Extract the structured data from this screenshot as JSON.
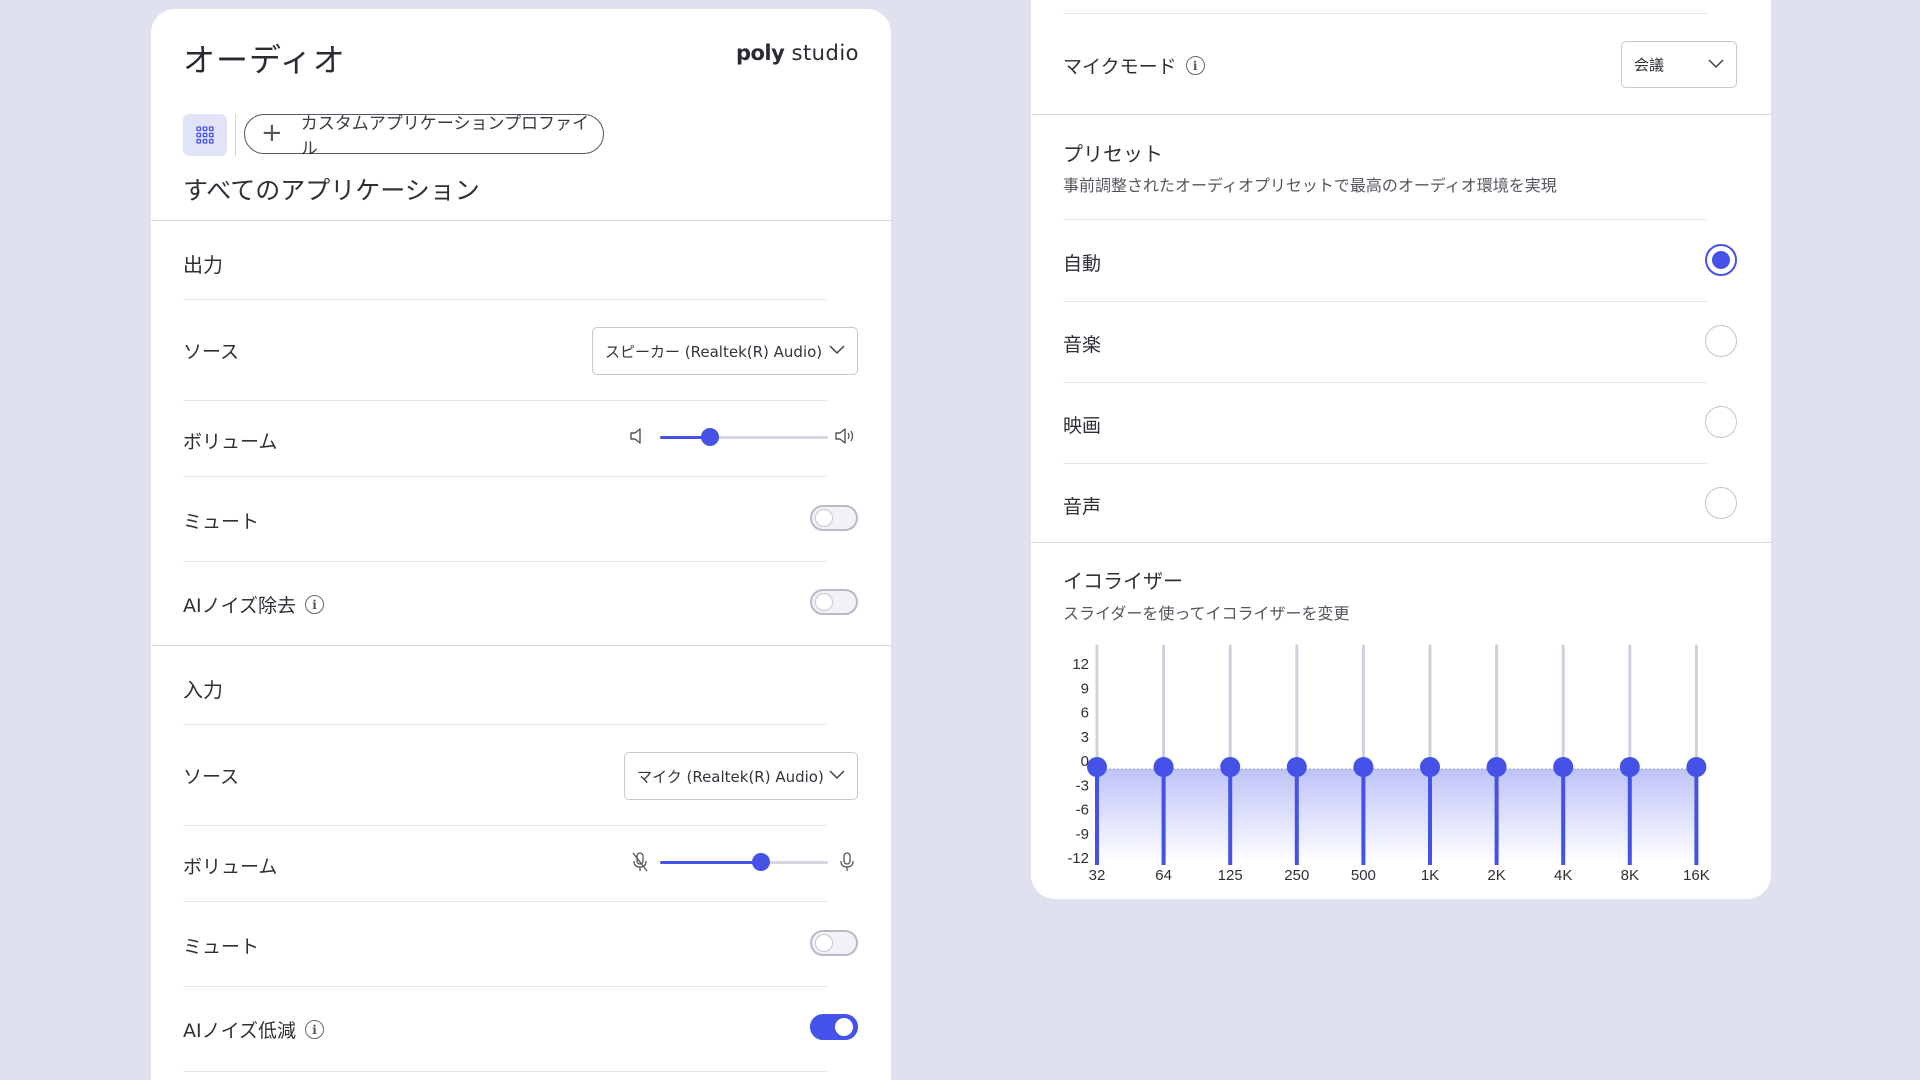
{
  "header": {
    "title": "オーディオ",
    "logo_bold": "poly",
    "logo_light": "studio"
  },
  "profiles": {
    "add_label": "カスタムアプリケーションプロファイル",
    "current": "すべてのアプリケーション"
  },
  "output": {
    "title": "出力",
    "source_label": "ソース",
    "source_value": "スピーカー (Realtek(R) Audio)",
    "volume_label": "ボリューム",
    "volume": 0.3,
    "mute_label": "ミュート",
    "mute_on": false,
    "noise_label": "AIノイズ除去",
    "noise_on": false
  },
  "input": {
    "title": "入力",
    "source_label": "ソース",
    "source_value": "マイク (Realtek(R) Audio)",
    "volume_label": "ボリューム",
    "volume": 0.6,
    "mute_label": "ミュート",
    "mute_on": false,
    "noise_label": "AIノイズ低減",
    "noise_on": true
  },
  "mic_mode": {
    "label": "マイクモード",
    "value": "会議"
  },
  "preset": {
    "title": "プリセット",
    "subtitle": "事前調整されたオーディオプリセットで最高のオーディオ環境を実現",
    "options": [
      {
        "label": "自動",
        "selected": true
      },
      {
        "label": "音楽",
        "selected": false
      },
      {
        "label": "映画",
        "selected": false
      },
      {
        "label": "音声",
        "selected": false
      }
    ]
  },
  "equalizer": {
    "title": "イコライザー",
    "subtitle": "スライダーを使ってイコライザーを変更",
    "y_ticks": [
      "12",
      "9",
      "6",
      "3",
      "0",
      "-3",
      "-6",
      "-9",
      "-12"
    ],
    "ylim": [
      -12,
      12
    ],
    "bands": [
      {
        "label": "32",
        "gain": 0
      },
      {
        "label": "64",
        "gain": 0
      },
      {
        "label": "125",
        "gain": 0
      },
      {
        "label": "250",
        "gain": 0
      },
      {
        "label": "500",
        "gain": 0
      },
      {
        "label": "1K",
        "gain": 0
      },
      {
        "label": "2K",
        "gain": 0
      },
      {
        "label": "4K",
        "gain": 0
      },
      {
        "label": "8K",
        "gain": 0
      },
      {
        "label": "16K",
        "gain": 0
      }
    ]
  },
  "colors": {
    "accent": "#4452e8",
    "background": "#dfe1ee",
    "panel": "#ffffff"
  }
}
